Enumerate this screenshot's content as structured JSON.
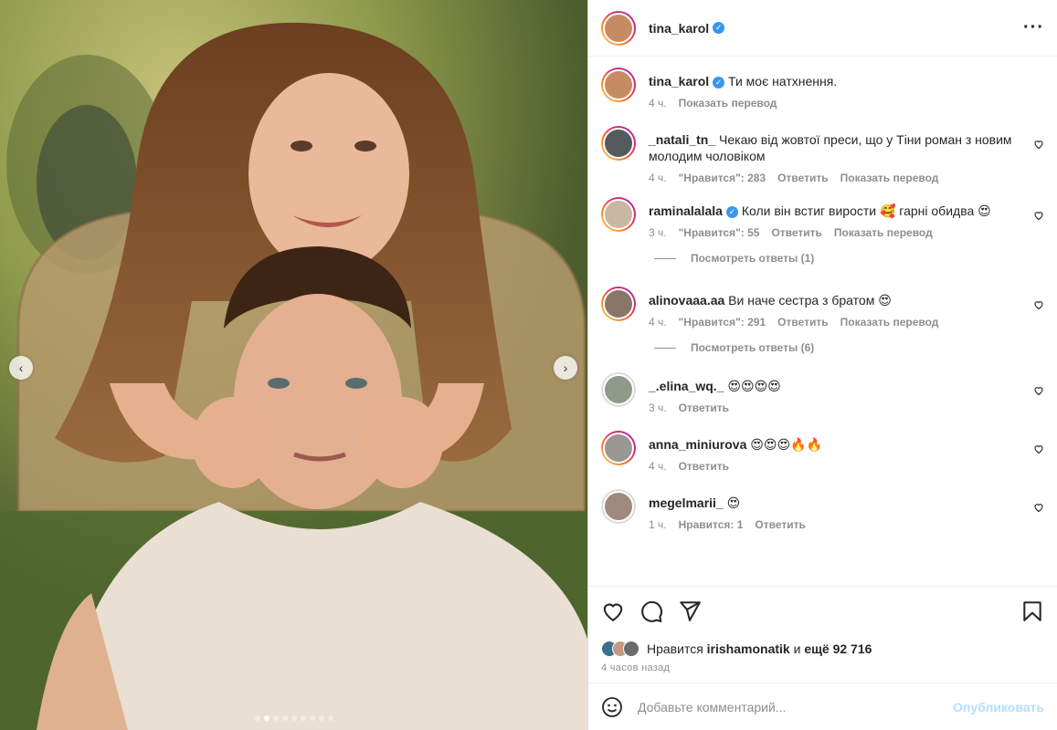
{
  "post": {
    "author": "tina_karol",
    "verified": true,
    "carousel": {
      "total": 9,
      "active": 1
    }
  },
  "caption": {
    "user": "tina_karol",
    "text": "Ти моє натхнення.",
    "time": "4 ч.",
    "translate": "Показать перевод"
  },
  "comments": [
    {
      "user": "_natali_tn_",
      "text": "Чекаю від жовтої преси, що у Тіни роман з новим молодим чоловіком",
      "time": "4 ч.",
      "likes": "\"Нравится\": 283",
      "reply": "Ответить",
      "translate": "Показать перевод",
      "avatar_color": "#555a5e",
      "ring": true
    },
    {
      "user": "raminalalala",
      "verified": true,
      "text": "Коли він встиг вирости 🥰 гарні обидва 😍",
      "time": "3 ч.",
      "likes": "\"Нравится\": 55",
      "reply": "Ответить",
      "translate": "Показать перевод",
      "avatar_color": "#c9b7a4",
      "ring": true
    },
    {
      "user": "alinovaaa.aa",
      "text": "Ви наче сестра з братом 😍",
      "time": "4 ч.",
      "likes": "\"Нравится\": 291",
      "reply": "Ответить",
      "translate": "Показать перевод",
      "avatar_color": "#8a7667",
      "ring": true
    },
    {
      "user": "_.elina_wq._",
      "text": "😍😍😍😍",
      "time": "3 ч.",
      "reply": "Ответить",
      "avatar_color": "#8f9a8a",
      "ring": false
    },
    {
      "user": "anna_miniurova",
      "text": "😍😍😍🔥🔥",
      "time": "4 ч.",
      "reply": "Ответить",
      "avatar_color": "#9b9894",
      "ring": true
    },
    {
      "user": "megelmarii_",
      "text": "😍",
      "time": "1 ч.",
      "likes": "Нравится: 1",
      "reply": "Ответить",
      "avatar_color": "#a08a7c",
      "ring": false
    }
  ],
  "replies_links": [
    "Посмотреть ответы (1)",
    "Посмотреть ответы (6)"
  ],
  "likes": {
    "prefix": "Нравится",
    "user": "irishamonatik",
    "and": "и",
    "rest": "ещё 92 716"
  },
  "time_ago": "4 часов назад",
  "add_comment": {
    "placeholder": "Добавьте комментарий...",
    "publish": "Опубликовать"
  },
  "colors": {
    "verified": "#3897f0",
    "publish": "#b2dffc",
    "muted": "#8e8e8e"
  },
  "icons": [
    "more-icon",
    "heart-icon",
    "comment-icon",
    "share-icon",
    "save-icon",
    "emoji-icon",
    "chevron-left-icon",
    "chevron-right-icon",
    "verified-icon"
  ]
}
